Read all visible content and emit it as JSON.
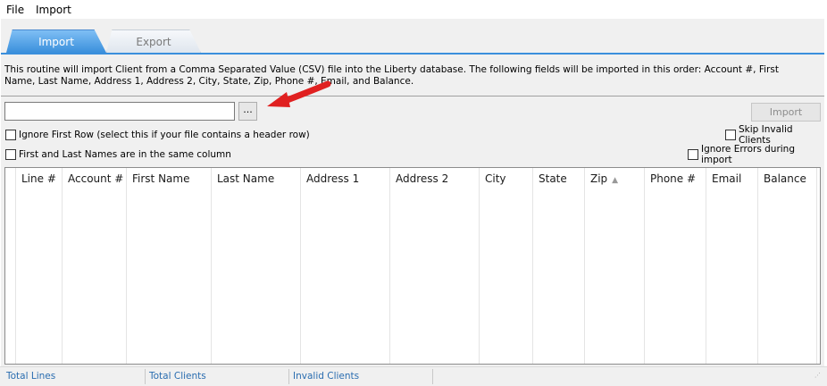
{
  "menu": {
    "file": "File",
    "import": "Import"
  },
  "tabs": {
    "import": "Import",
    "export": "Export"
  },
  "description": "This routine will import Client from a Comma Separated Value (CSV) file into the Liberty database.  The following fields will be imported in this order: Account #, First Name, Last Name, Address 1, Address 2, City, State, Zip, Phone #, Email, and Balance.",
  "file_path": {
    "value": "",
    "placeholder": ""
  },
  "browse_label": "...",
  "import_button": "Import",
  "options": {
    "ignore_first_row": "Ignore First Row (select this if your file contains a header row)",
    "same_column": "First and Last Names are in the same column",
    "skip_invalid": "Skip Invalid Clients",
    "ignore_errors": "Ignore Errors during import"
  },
  "grid": {
    "columns": [
      "Line #",
      "Account #",
      "First Name",
      "Last Name",
      "Address 1",
      "Address 2",
      "City",
      "State",
      "Zip",
      "Phone #",
      "Email",
      "Balance"
    ],
    "sorted_column": "Zip",
    "rows": []
  },
  "status": {
    "total_lines": "Total Lines",
    "total_clients": "Total Clients",
    "invalid_clients": "Invalid Clients"
  },
  "colors": {
    "accent": "#3a8fdc",
    "arrow": "#e02020",
    "status_text": "#2a6db0"
  },
  "icons": {
    "sort": "sort-ascending-icon",
    "annotation": "red-arrow-icon",
    "grip": "resize-grip-icon"
  }
}
